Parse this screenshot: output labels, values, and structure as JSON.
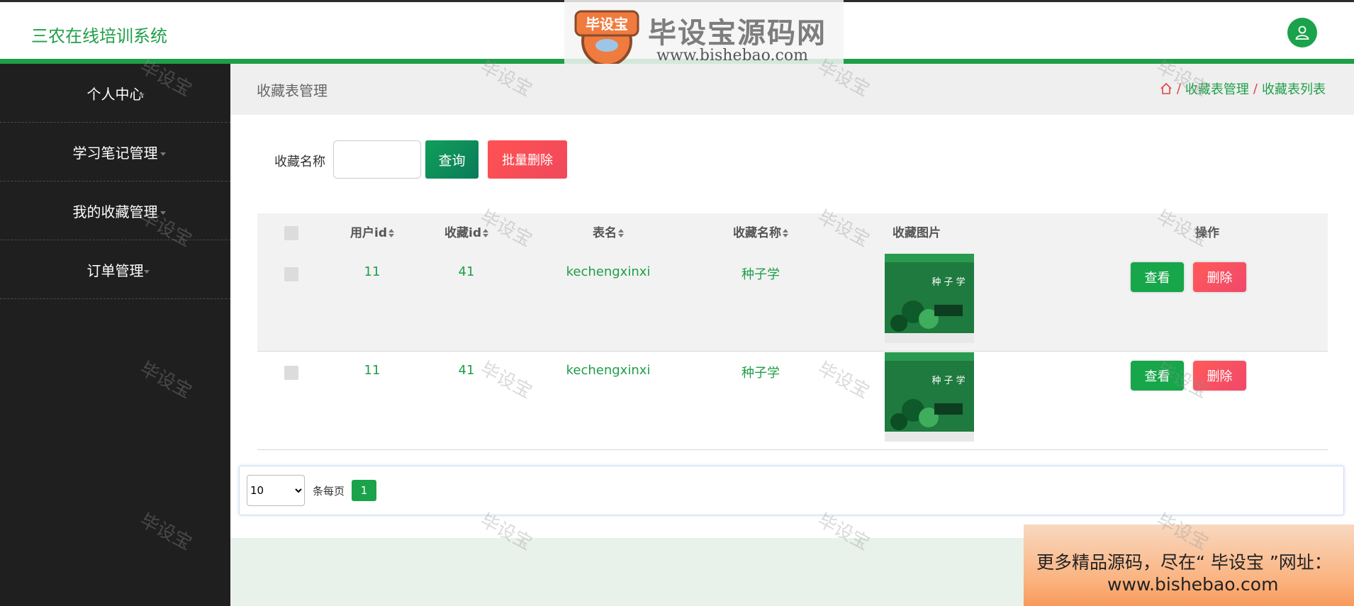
{
  "app": {
    "title": "三农在线培训系统"
  },
  "logo": {
    "badge_text": "毕设宝",
    "name": "毕设宝源码网",
    "url": "www.bishebao.com"
  },
  "sidebar": {
    "items": [
      {
        "label": "个人中心"
      },
      {
        "label": "学习笔记管理"
      },
      {
        "label": "我的收藏管理"
      },
      {
        "label": "订单管理"
      }
    ]
  },
  "header": {
    "title": "收藏表管理",
    "breadcrumb": [
      "收藏表管理",
      "收藏表列表"
    ]
  },
  "search": {
    "label": "收藏名称",
    "value": "",
    "query_label": "查询",
    "batch_delete_label": "批量删除"
  },
  "table": {
    "columns": [
      "用户id",
      "收藏id",
      "表名",
      "收藏名称",
      "收藏图片",
      "操作"
    ],
    "rows": [
      {
        "user_id": "11",
        "fav_id": "41",
        "table_name": "kechengxinxi",
        "fav_name": "种子学",
        "view_label": "查看",
        "delete_label": "删除"
      },
      {
        "user_id": "11",
        "fav_id": "41",
        "table_name": "kechengxinxi",
        "fav_name": "种子学",
        "view_label": "查看",
        "delete_label": "删除"
      }
    ],
    "cover_title": "种 子 学"
  },
  "pagination": {
    "page_size": "10",
    "page_size_options": [
      "10"
    ],
    "per_page_label": "条每页",
    "current_page": "1"
  },
  "promo": {
    "line1": "更多精品源码，尽在“ 毕设宝 ”网址：",
    "line2": "www.bishebao.com"
  },
  "watermark": "毕设宝",
  "colors": {
    "accent": "#1f9e48",
    "danger": "#f0485c",
    "sidebar": "#1f1f1f"
  }
}
